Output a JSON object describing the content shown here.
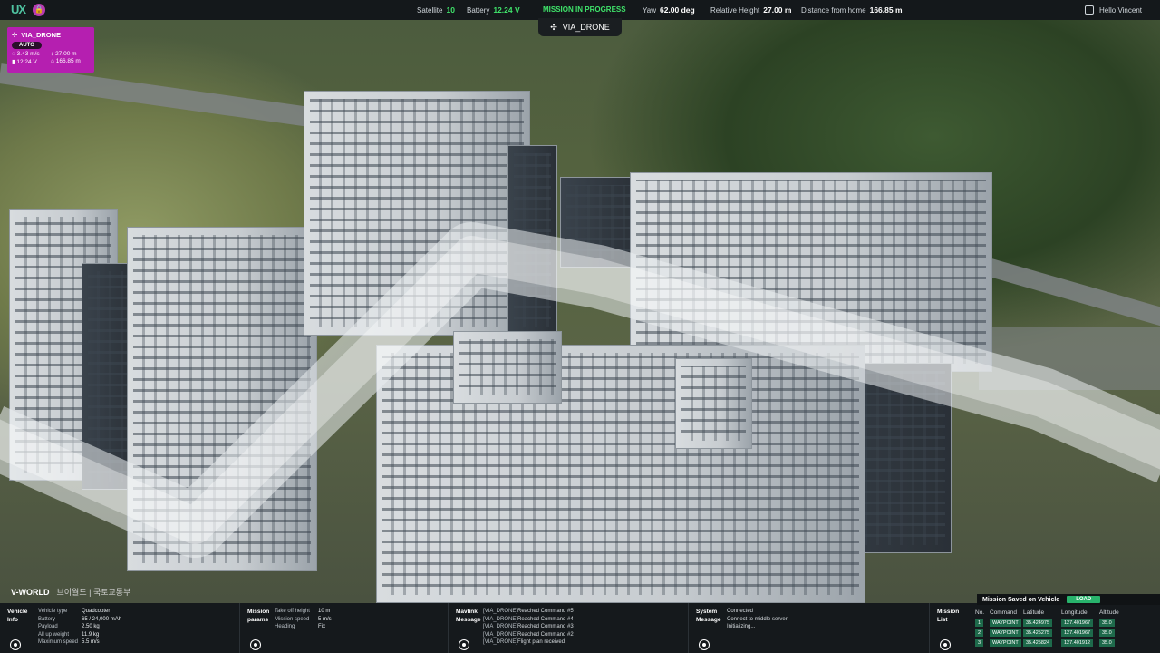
{
  "topbar": {
    "logo": "UX",
    "lock_icon": "lock-icon",
    "satellite_label": "Satellite",
    "satellite_value": "10",
    "battery_label": "Battery",
    "battery_value": "12.24 V",
    "status": "MISSION IN PROGRESS",
    "yaw_label": "Yaw",
    "yaw_value": "62.00 deg",
    "rel_height_label": "Relative Height",
    "rel_height_value": "27.00 m",
    "distance_label": "Distance from home",
    "distance_value": "166.85 m",
    "user_greeting": "Hello Vincent"
  },
  "drone_tab": {
    "name": "VIA_DRONE"
  },
  "drone_card": {
    "name": "VIA_DRONE",
    "mode": "AUTO",
    "speed": "3.43 m/s",
    "height": "27.00 m",
    "voltage": "12.24 V",
    "distance": "166.85 m",
    "color": "#b51fb0"
  },
  "map": {
    "watermark": "V-WORLD",
    "watermark_sub": "브이월드 | 국토교통부"
  },
  "vehicle_info": {
    "title": "Vehicle Info",
    "rows": [
      {
        "k": "Vehicle type",
        "v": "Quadcopter"
      },
      {
        "k": "Battery",
        "v": "65 / 24,000 mAh"
      },
      {
        "k": "Payload",
        "v": "2.50 kg"
      },
      {
        "k": "All up weight",
        "v": "11.9 kg"
      },
      {
        "k": "Maximum speed",
        "v": "5.5 m/s"
      }
    ]
  },
  "mission_params": {
    "title": "Mission params",
    "rows": [
      {
        "k": "Take off height",
        "v": "10 m"
      },
      {
        "k": "Mission speed",
        "v": "5 m/s"
      },
      {
        "k": "Heading",
        "v": "Fix"
      }
    ]
  },
  "mavlink": {
    "title": "Mavlink Message",
    "rows": [
      {
        "src": "[VIA_DRONE]",
        "msg": "Reached Command #5"
      },
      {
        "src": "[VIA_DRONE]",
        "msg": "Reached Command #4"
      },
      {
        "src": "[VIA_DRONE]",
        "msg": "Reached Command #3"
      },
      {
        "src": "[VIA_DRONE]",
        "msg": "Reached Command #2"
      },
      {
        "src": "[VIA_DRONE]",
        "msg": "Flight plan received"
      }
    ]
  },
  "system_message": {
    "title": "System Message",
    "rows": [
      "Connected",
      "Connect to middle server",
      "Initializing..."
    ]
  },
  "mission_list": {
    "title": "Mission List",
    "saved_label": "Mission Saved on Vehicle",
    "load_label": "LOAD",
    "headers": {
      "no": "No.",
      "command": "Command",
      "latitude": "Latitude",
      "longitude": "Longitude",
      "altitude": "Altitude"
    },
    "rows": [
      {
        "no": "1",
        "command": "WAYPOINT",
        "lat": "35.424975",
        "lon": "127.401967",
        "alt": "35.0"
      },
      {
        "no": "2",
        "command": "WAYPOINT",
        "lat": "35.425275",
        "lon": "127.401967",
        "alt": "35.0"
      },
      {
        "no": "3",
        "command": "WAYPOINT",
        "lat": "35.425824",
        "lon": "127.401912",
        "alt": "35.0"
      }
    ]
  }
}
